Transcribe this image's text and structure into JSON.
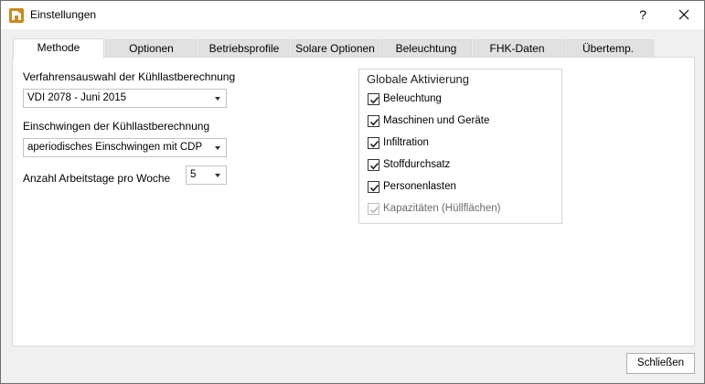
{
  "window": {
    "title": "Einstellungen",
    "help_label": "?",
    "icon": "app-logo-icon"
  },
  "tabs": [
    {
      "label": "Methode",
      "active": true
    },
    {
      "label": "Optionen",
      "active": false
    },
    {
      "label": "Betriebsprofile",
      "active": false
    },
    {
      "label": "Solare Optionen",
      "active": false
    },
    {
      "label": "Beleuchtung",
      "active": false
    },
    {
      "label": "FHK-Daten",
      "active": false
    },
    {
      "label": "Übertemp.",
      "active": false
    }
  ],
  "method": {
    "procedure_label": "Verfahrensauswahl der Kühllastberechnung",
    "procedure_value": "VDI 2078 - Juni 2015",
    "settling_label": "Einschwingen der Kühllastberechnung",
    "settling_value": "aperiodisches Einschwingen mit CDP",
    "workdays_label": "Anzahl Arbeitstage pro Woche",
    "workdays_value": "5"
  },
  "global_activation": {
    "title": "Globale Aktivierung",
    "items": [
      {
        "label": "Beleuchtung",
        "checked": true,
        "enabled": true
      },
      {
        "label": "Maschinen und Geräte",
        "checked": true,
        "enabled": true
      },
      {
        "label": "Infiltration",
        "checked": true,
        "enabled": true
      },
      {
        "label": "Stoffdurchsatz",
        "checked": true,
        "enabled": true
      },
      {
        "label": "Personenlasten",
        "checked": true,
        "enabled": true
      },
      {
        "label": "Kapazitäten (Hüllflächen)",
        "checked": true,
        "enabled": false
      }
    ]
  },
  "footer": {
    "close_label": "Schließen"
  }
}
